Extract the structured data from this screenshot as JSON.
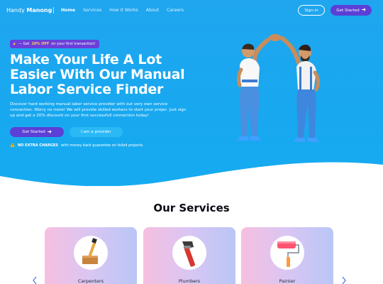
{
  "nav": {
    "logo_light": "Handy",
    "logo_bold": "Manong",
    "links": [
      "Home",
      "Services",
      "How It Works",
      "About",
      "Careers"
    ],
    "signin_label": "Sign-in",
    "get_started_label": "Get Started"
  },
  "hero": {
    "promo_prefix": "— Get",
    "promo_highlight": "20% OFF",
    "promo_suffix": "on your first transaction!",
    "headline": "Make Your Life A Lot Easier With Our Manual Labor Service Finder",
    "description": "Discover hard working manual labor service provider with out very own service connection. Worry no more! We will provide skilled workers to start your projec. Just sign up and get a 20% discount on your first successfull connection today!",
    "get_started_label": "Get Started",
    "provider_label": "I am a provider",
    "notice_bold": "NO EXTRA CHARGES",
    "notice_rest": "with money back guarantee on failed projects."
  },
  "services": {
    "title": "Our Services",
    "cards": [
      {
        "label": "Carpenters",
        "icon": "hammer-mallet-icon"
      },
      {
        "label": "Plumbers",
        "icon": "pipe-wrench-icon"
      },
      {
        "label": "Painter",
        "icon": "paint-roller-icon"
      }
    ]
  },
  "colors": {
    "hero_blue": "#1fa6ef",
    "accent_purple": "#5b3fd6",
    "provider_blue": "#2ab9f5",
    "promo_yellow": "#ffd34d"
  }
}
